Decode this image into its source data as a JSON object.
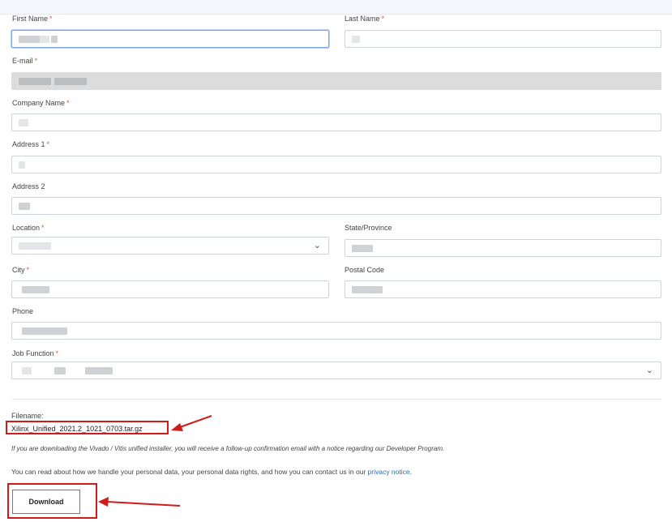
{
  "form": {
    "first_name": {
      "label": "First Name",
      "required": "*"
    },
    "last_name": {
      "label": "Last Name",
      "required": "*"
    },
    "email": {
      "label": "E-mail",
      "required": "*"
    },
    "company": {
      "label": "Company Name",
      "required": "*"
    },
    "address1": {
      "label": "Address 1",
      "required": "*"
    },
    "address2": {
      "label": "Address 2"
    },
    "location": {
      "label": "Location",
      "required": "*"
    },
    "state": {
      "label": "State/Province"
    },
    "city": {
      "label": "City",
      "required": "*"
    },
    "postal": {
      "label": "Postal Code"
    },
    "phone": {
      "label": "Phone"
    },
    "job": {
      "label": "Job Function",
      "required": "*"
    }
  },
  "download": {
    "filename_label": "Filename:",
    "filename": "Xilinx_Unified_2021.2_1021_0703.tar.gz",
    "note": "If you are downloading the Vivado / Vitis unified installer, you will receive a follow-up confirmation email with a notice regarding our Developer Program.",
    "privacy_text": "You can read about how we handle your personal data, your personal data rights, and how you can contact us in our",
    "privacy_link": "privacy notice",
    "privacy_end": ".",
    "button_label": "Download"
  },
  "icons": {
    "dropdown": "chevron-down-icon",
    "annotation": "red-arrow-icon"
  },
  "colors": {
    "required": "#d9534f",
    "highlight": "#d11a1a",
    "link": "#2a6ebb"
  }
}
